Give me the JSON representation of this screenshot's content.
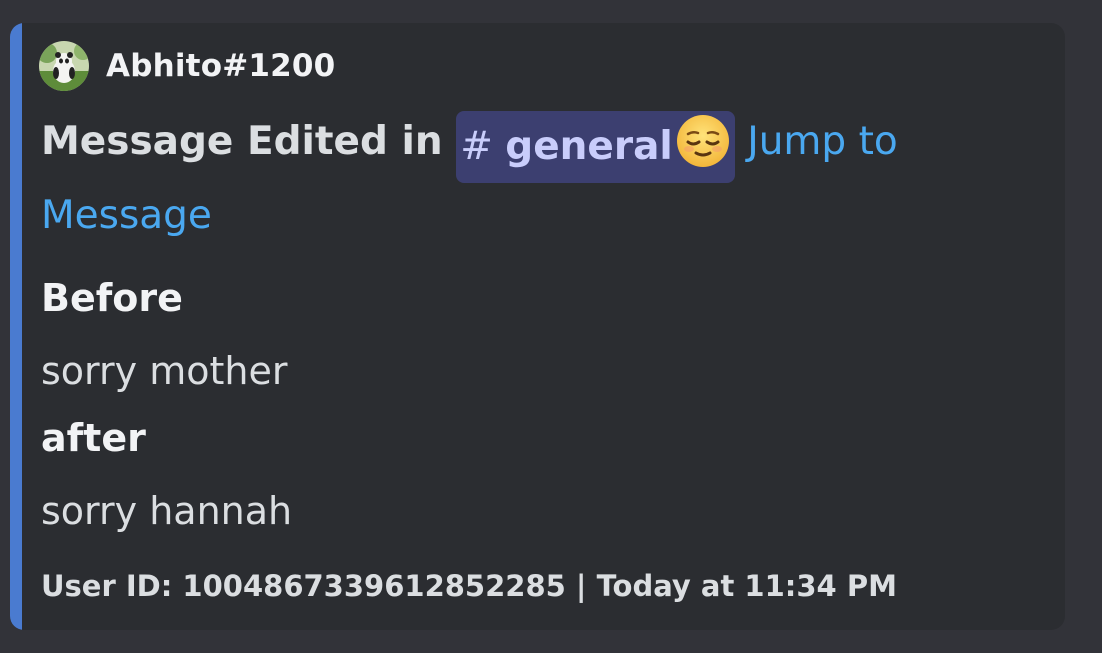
{
  "author": {
    "name": "Abhito#1200",
    "avatar_icon": "panda-avatar-icon"
  },
  "title": {
    "prefix": "Message Edited in ",
    "channel_hash": "#",
    "channel_name": "general",
    "emoji": "relieved-face-emoji",
    "link_text": "Jump to Message"
  },
  "fields": [
    {
      "name": "Before",
      "value": "sorry mother"
    },
    {
      "name": "after",
      "value": "sorry hannah"
    }
  ],
  "footer": {
    "text": "User ID: 1004867339612852285 | Today at 11:34 PM"
  },
  "colors": {
    "embed_bar": "#4a7bd0",
    "embed_bg": "#2b2d31",
    "link": "#4aa8f0",
    "mention_bg": "#3c3f70"
  }
}
